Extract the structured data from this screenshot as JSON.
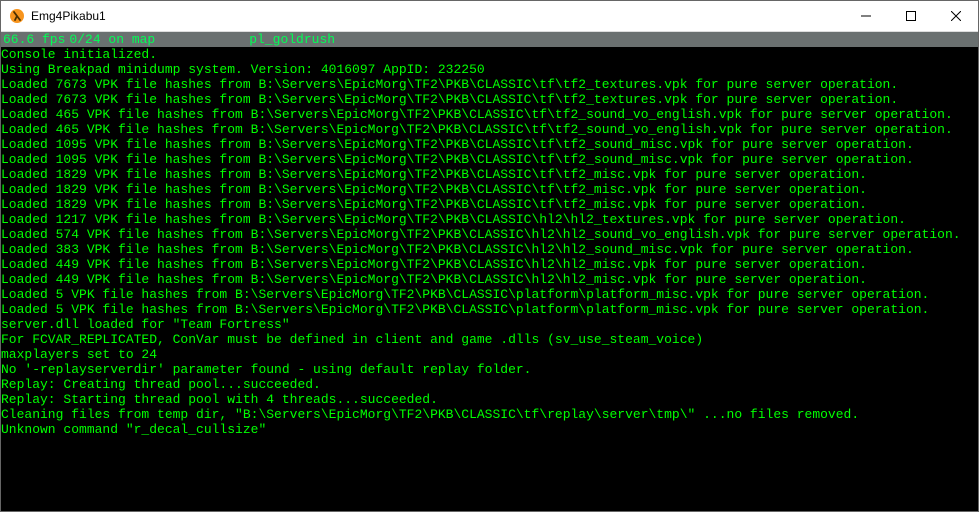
{
  "window": {
    "title": "Emg4Pikabu1",
    "minimize_label": "—",
    "maximize_label": "☐",
    "close_label": "✕"
  },
  "status": {
    "fps": "66.6 fps",
    "on_map": "0/24 on map",
    "map": "pl_goldrush"
  },
  "console_lines": [
    "Console initialized.",
    "Using Breakpad minidump system. Version: 4016097 AppID: 232250",
    "Loaded 7673 VPK file hashes from B:\\Servers\\EpicMorg\\TF2\\PKB\\CLASSIC\\tf\\tf2_textures.vpk for pure server operation.",
    "Loaded 7673 VPK file hashes from B:\\Servers\\EpicMorg\\TF2\\PKB\\CLASSIC\\tf\\tf2_textures.vpk for pure server operation.",
    "Loaded 465 VPK file hashes from B:\\Servers\\EpicMorg\\TF2\\PKB\\CLASSIC\\tf\\tf2_sound_vo_english.vpk for pure server operation.",
    "Loaded 465 VPK file hashes from B:\\Servers\\EpicMorg\\TF2\\PKB\\CLASSIC\\tf\\tf2_sound_vo_english.vpk for pure server operation.",
    "Loaded 1095 VPK file hashes from B:\\Servers\\EpicMorg\\TF2\\PKB\\CLASSIC\\tf\\tf2_sound_misc.vpk for pure server operation.",
    "Loaded 1095 VPK file hashes from B:\\Servers\\EpicMorg\\TF2\\PKB\\CLASSIC\\tf\\tf2_sound_misc.vpk for pure server operation.",
    "Loaded 1829 VPK file hashes from B:\\Servers\\EpicMorg\\TF2\\PKB\\CLASSIC\\tf\\tf2_misc.vpk for pure server operation.",
    "Loaded 1829 VPK file hashes from B:\\Servers\\EpicMorg\\TF2\\PKB\\CLASSIC\\tf\\tf2_misc.vpk for pure server operation.",
    "Loaded 1829 VPK file hashes from B:\\Servers\\EpicMorg\\TF2\\PKB\\CLASSIC\\tf\\tf2_misc.vpk for pure server operation.",
    "Loaded 1217 VPK file hashes from B:\\Servers\\EpicMorg\\TF2\\PKB\\CLASSIC\\hl2\\hl2_textures.vpk for pure server operation.",
    "Loaded 574 VPK file hashes from B:\\Servers\\EpicMorg\\TF2\\PKB\\CLASSIC\\hl2\\hl2_sound_vo_english.vpk for pure server operation.",
    "Loaded 383 VPK file hashes from B:\\Servers\\EpicMorg\\TF2\\PKB\\CLASSIC\\hl2\\hl2_sound_misc.vpk for pure server operation.",
    "Loaded 449 VPK file hashes from B:\\Servers\\EpicMorg\\TF2\\PKB\\CLASSIC\\hl2\\hl2_misc.vpk for pure server operation.",
    "Loaded 449 VPK file hashes from B:\\Servers\\EpicMorg\\TF2\\PKB\\CLASSIC\\hl2\\hl2_misc.vpk for pure server operation.",
    "Loaded 5 VPK file hashes from B:\\Servers\\EpicMorg\\TF2\\PKB\\CLASSIC\\platform\\platform_misc.vpk for pure server operation.",
    "Loaded 5 VPK file hashes from B:\\Servers\\EpicMorg\\TF2\\PKB\\CLASSIC\\platform\\platform_misc.vpk for pure server operation.",
    "server.dll loaded for \"Team Fortress\"",
    "For FCVAR_REPLICATED, ConVar must be defined in client and game .dlls (sv_use_steam_voice)",
    "maxplayers set to 24",
    "No '-replayserverdir' parameter found - using default replay folder.",
    "Replay: Creating thread pool...succeeded.",
    "Replay: Starting thread pool with 4 threads...succeeded.",
    "Cleaning files from temp dir, \"B:\\Servers\\EpicMorg\\TF2\\PKB\\CLASSIC\\tf\\replay\\server\\tmp\\\" ...no files removed.",
    "Unknown command \"r_decal_cullsize\""
  ]
}
